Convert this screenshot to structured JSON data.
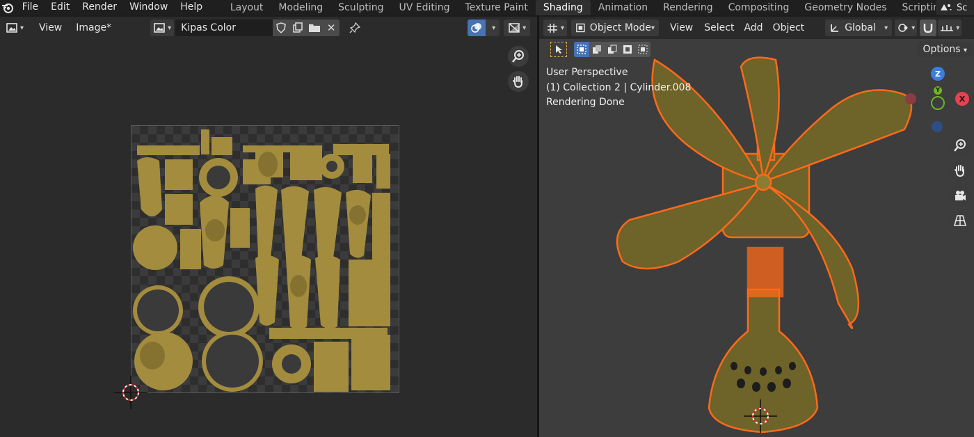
{
  "topbar": {
    "menus": [
      "File",
      "Edit",
      "Render",
      "Window",
      "Help"
    ],
    "workspaces": [
      "Layout",
      "Modeling",
      "Sculpting",
      "UV Editing",
      "Texture Paint",
      "Shading",
      "Animation",
      "Rendering",
      "Compositing",
      "Geometry Nodes",
      "Scripting"
    ],
    "active_workspace": "Shading",
    "add_tab": "+",
    "scene_label": "Sc"
  },
  "image_editor": {
    "view_menu": "View",
    "image_menu": "Image*",
    "image_name": "Kipas Color"
  },
  "viewport": {
    "mode": "Object Mode",
    "menus": [
      "View",
      "Select",
      "Add",
      "Object"
    ],
    "transform_orientation": "Global",
    "options_label": "Options",
    "overlay_lines": [
      "User Perspective",
      "(1) Collection 2 | Cylinder.008",
      "Rendering Done"
    ],
    "gizmo": {
      "z": "Z",
      "y": "Y",
      "x": "X"
    }
  },
  "colors": {
    "accent_blue": "#4772b3",
    "texture_gold": "#a38c3e",
    "selection_orange": "#ff6a1a",
    "axis_x": "#e8414f",
    "axis_y": "#6fb525",
    "axis_z": "#3c7ddb"
  }
}
